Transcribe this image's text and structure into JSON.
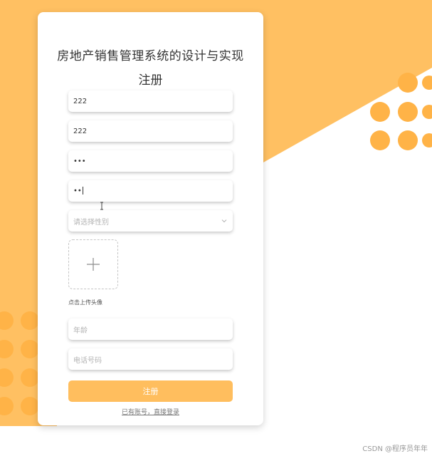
{
  "page": {
    "title": "房地产销售管理系统的设计与实现",
    "subtitle": "注册"
  },
  "form": {
    "fields": [
      {
        "name": "username",
        "value": "222",
        "placeholder": ""
      },
      {
        "name": "name",
        "value": "222",
        "placeholder": ""
      },
      {
        "name": "password",
        "value": "•••",
        "placeholder": ""
      },
      {
        "name": "confirm-password",
        "value": "••",
        "placeholder": ""
      }
    ],
    "gender_select": {
      "placeholder": "请选择性别"
    },
    "upload_hint": "点击上传头像",
    "age": {
      "placeholder": "年龄"
    },
    "phone": {
      "placeholder": "电话号码"
    },
    "submit_label": "注册",
    "login_link": "已有账号，直接登录"
  },
  "watermark": "CSDN @程序员年年",
  "colors": {
    "accent": "#ffbe5e",
    "background_orange": "#ffc062",
    "dot_orange": "#ffb347"
  },
  "icons": {
    "select_arrow": "chevron-down-icon",
    "upload": "plus-icon",
    "mouse_cursor": "text-cursor-icon"
  }
}
